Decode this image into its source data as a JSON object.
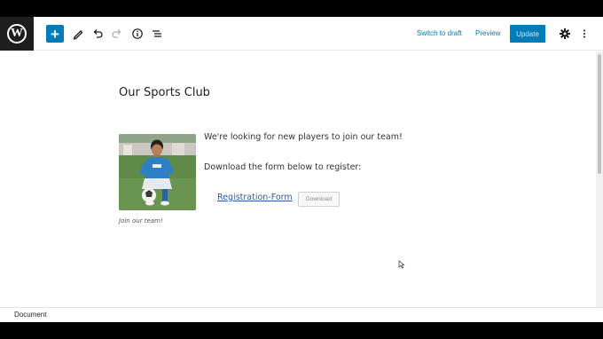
{
  "toolbar": {
    "logo_letter": "W",
    "add_symbol": "+",
    "switch_to_draft": "Switch to draft",
    "preview": "Preview",
    "update": "Update",
    "icons": [
      "wordpress-logo-icon",
      "plus-icon",
      "pencil-icon",
      "undo-icon",
      "redo-icon",
      "info-icon",
      "list-view-icon",
      "gear-icon",
      "more-vertical-icon"
    ]
  },
  "post": {
    "title": "Our Sports Club",
    "caption": "Join our team!",
    "paragraph_1": "We're looking for new players to join our team!",
    "paragraph_2": "Download the form below to register:",
    "file_name": "Registration-Form",
    "download_label": "Download"
  },
  "footer": {
    "breadcrumb": "Document"
  },
  "colors": {
    "accent": "#007cba",
    "logo_bg": "#1e1e1e",
    "link": "#2c5aa0"
  }
}
